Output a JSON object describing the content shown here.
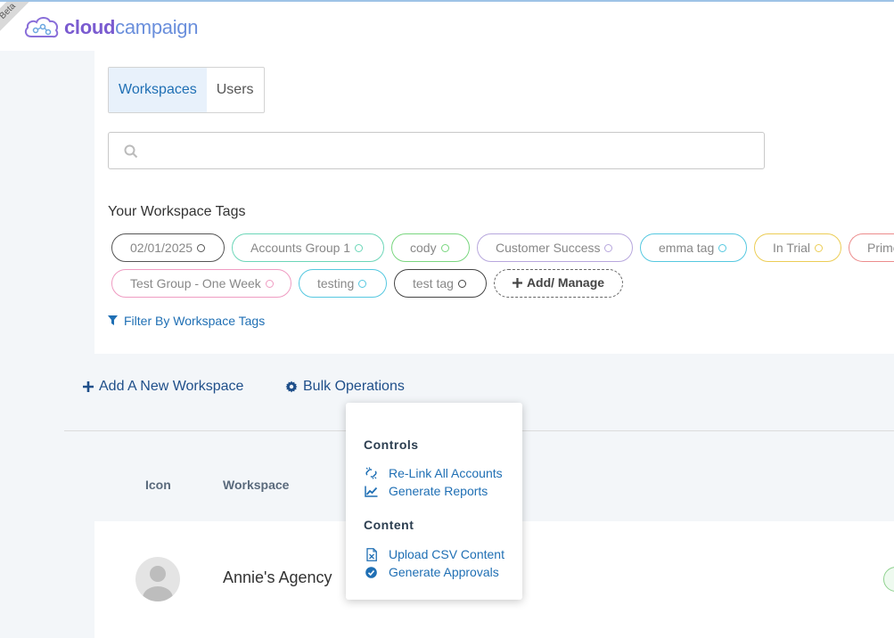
{
  "header": {
    "beta_label": "Beta",
    "logo_bold": "cloud",
    "logo_light": "campaign"
  },
  "tabs": [
    {
      "label": "Workspaces"
    },
    {
      "label": "Users"
    }
  ],
  "search": {
    "value": "",
    "placeholder": ""
  },
  "tags_section": {
    "title": "Your Workspace Tags",
    "tags": [
      {
        "label": "02/01/2025",
        "color": "#555555"
      },
      {
        "label": "Accounts Group 1",
        "color": "#6cd6b8"
      },
      {
        "label": "cody",
        "color": "#79d67f"
      },
      {
        "label": "Customer Success",
        "color": "#b7a7dd"
      },
      {
        "label": "emma tag",
        "color": "#55c8e0"
      },
      {
        "label": "In Trial",
        "color": "#eccd55"
      },
      {
        "label": "Prime",
        "color": "#ec8c8c"
      },
      {
        "label": "Test Group - One Week",
        "color": "#ef9cc2"
      },
      {
        "label": "testing",
        "color": "#55c8e0"
      },
      {
        "label": "test tag",
        "color": "#444444"
      }
    ],
    "add_manage_label": "Add/ Manage",
    "filter_label": "Filter By Workspace Tags"
  },
  "actions": {
    "add_workspace": "Add A New Workspace",
    "bulk_operations": "Bulk Operations"
  },
  "table": {
    "columns": {
      "icon": "Icon",
      "workspace": "Workspace"
    },
    "rows": [
      {
        "name": "Annie's Agency"
      }
    ]
  },
  "bulk_menu": {
    "controls_heading": "Controls",
    "relink": "Re-Link All Accounts",
    "reports": "Generate Reports",
    "content_heading": "Content",
    "upload_csv": "Upload CSV Content",
    "approvals": "Generate Approvals"
  }
}
